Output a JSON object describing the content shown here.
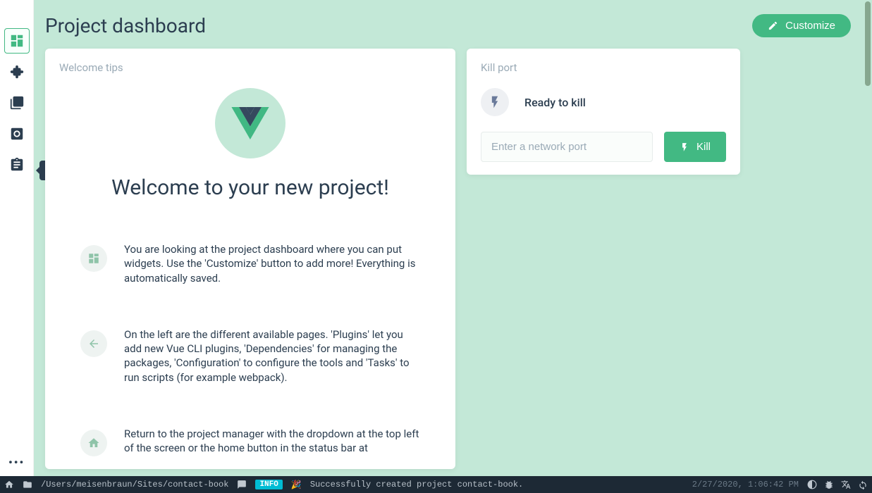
{
  "header": {
    "title": "Project dashboard",
    "customize_label": "Customize"
  },
  "sidebar": {
    "tooltip_tasks": "Tasks"
  },
  "welcome": {
    "card_title": "Welcome tips",
    "heading": "Welcome to your new project!",
    "tips": [
      "You are looking at the project dashboard where you can put widgets. Use the 'Customize' button to add more! Everything is automatically saved.",
      "On the left are the different available pages. 'Plugins' let you add new Vue CLI plugins, 'Dependencies' for managing the packages, 'Configuration' to configure the tools and 'Tasks' to run scripts (for example webpack).",
      "Return to the project manager with the dropdown at the top left of the screen or the home button in the status bar at"
    ]
  },
  "killport": {
    "card_title": "Kill port",
    "status_text": "Ready to kill",
    "placeholder": "Enter a network port",
    "button_label": "Kill"
  },
  "statusbar": {
    "path": "/Users/meisenbraun/Sites/contact-book",
    "badge": "INFO",
    "emoji": "🎉",
    "message": "Successfully created project contact-book.",
    "timestamp": "2/27/2020, 1:06:42 PM"
  }
}
